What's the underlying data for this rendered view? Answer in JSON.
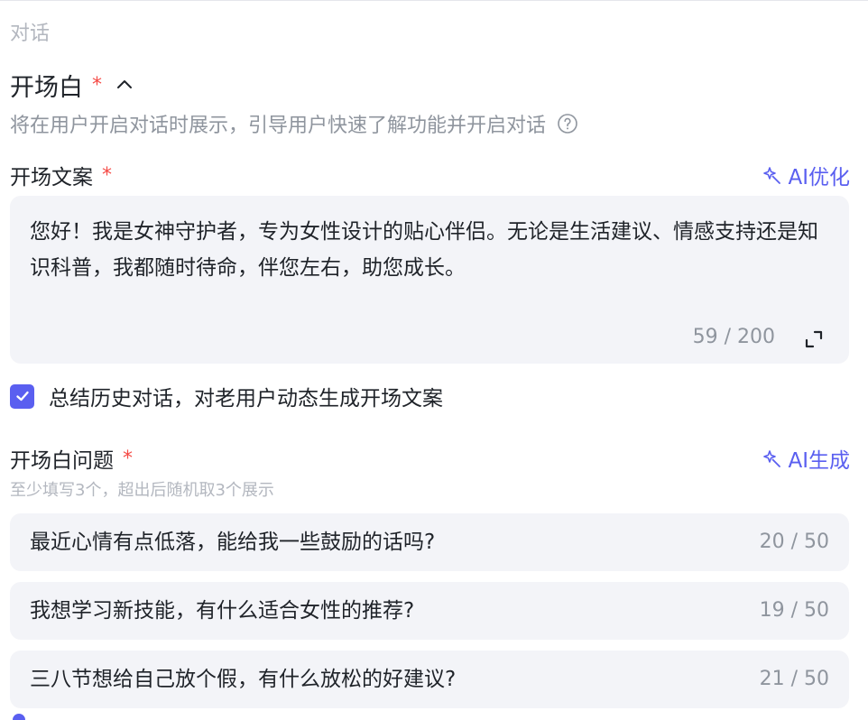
{
  "section": {
    "label": "对话"
  },
  "opening": {
    "title": "开场白",
    "required_mark": "*",
    "description": "将在用户开启对话时展示，引导用户快速了解功能并开启对话"
  },
  "opening_text": {
    "label": "开场文案",
    "required_mark": "*",
    "ai_button_label": "AI优化",
    "value": "您好！我是女神守护者，专为女性设计的贴心伴侣。无论是生活建议、情感支持还是知识科普，我都随时待命，伴您左右，助您成长。",
    "char_count": "59 / 200"
  },
  "summary_option": {
    "checked": true,
    "label": "总结历史对话，对老用户动态生成开场文案"
  },
  "opening_questions": {
    "label": "开场白问题",
    "required_mark": "*",
    "ai_button_label": "AI生成",
    "hint": "至少填写3个，超出后随机取3个展示",
    "items": [
      {
        "text": "最近心情有点低落，能给我一些鼓励的话吗?",
        "count": "20 / 50"
      },
      {
        "text": "我想学习新技能，有什么适合女性的推荐?",
        "count": "19 / 50"
      },
      {
        "text": "三八节想给自己放个假，有什么放松的好建议?",
        "count": "21 / 50"
      }
    ]
  },
  "colors": {
    "accent": "#5a5ff0",
    "required": "#f54a45",
    "field_bg": "#f3f4f8",
    "muted_text": "#8f959e"
  },
  "icons": {
    "collapse": "chevron-up-icon",
    "help": "question-circle-icon",
    "ai": "sparkle-icon",
    "expand": "expand-icon",
    "check": "check-icon"
  }
}
